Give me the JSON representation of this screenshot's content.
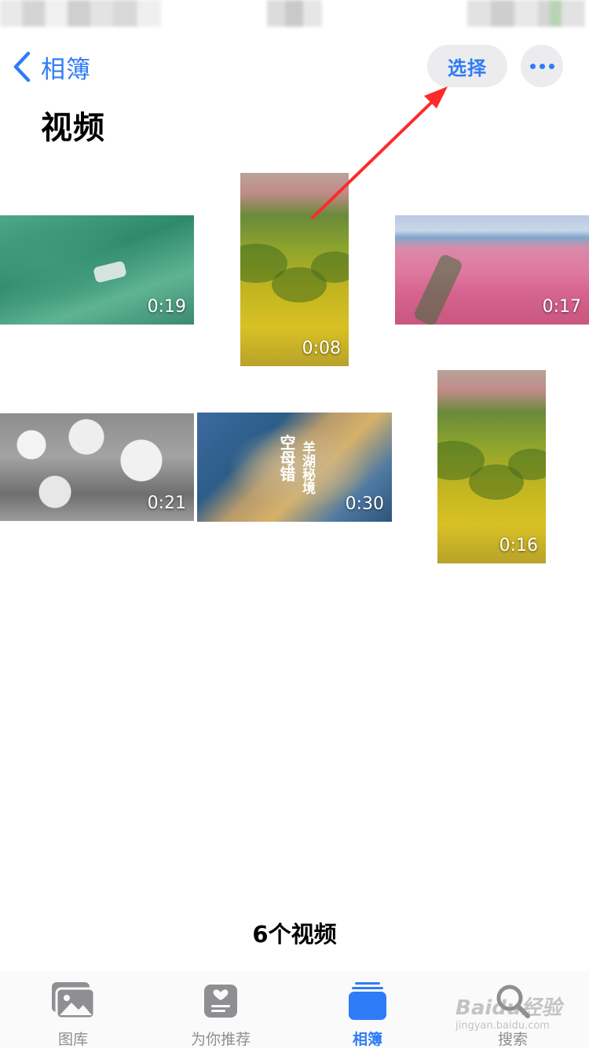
{
  "nav": {
    "back_label": "相簿",
    "select_label": "选择"
  },
  "page": {
    "title": "视频"
  },
  "videos": [
    {
      "duration": "0:19"
    },
    {
      "duration": "0:08"
    },
    {
      "duration": "0:17"
    },
    {
      "duration": "0:21"
    },
    {
      "duration": "0:30"
    },
    {
      "duration": "0:16"
    }
  ],
  "video5_caption": [
    "空",
    "母",
    "错",
    "羊",
    "湖",
    "秘",
    "境"
  ],
  "summary": {
    "count_text": "6个视频"
  },
  "tabbar": {
    "items": [
      {
        "label": "图库",
        "icon": "photo-library-icon",
        "active": false
      },
      {
        "label": "为你推荐",
        "icon": "for-you-icon",
        "active": false
      },
      {
        "label": "相簿",
        "icon": "albums-icon",
        "active": true
      },
      {
        "label": "搜索",
        "icon": "search-icon",
        "active": false
      }
    ]
  },
  "watermark": {
    "text": "Baidu经验",
    "sub": "jingyan.baidu.com"
  },
  "colors": {
    "accent": "#2f7cf6",
    "annotation": "#ff2a2a"
  }
}
